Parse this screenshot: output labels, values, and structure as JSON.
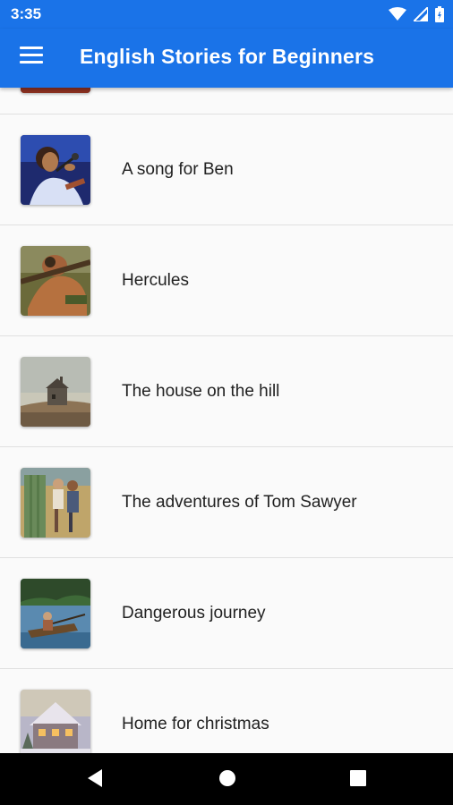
{
  "status_bar": {
    "time": "3:35",
    "icons": [
      "wifi-icon",
      "cell-signal-icon",
      "battery-icon"
    ]
  },
  "app_bar": {
    "menu_icon": "hamburger-menu-icon",
    "title": "English Stories for Beginners",
    "color": "#1a73e8"
  },
  "stories": [
    {
      "title": "",
      "thumbnail": "partial-story-thumbnail"
    },
    {
      "title": "A song for Ben",
      "thumbnail": "singer-with-microphone-image"
    },
    {
      "title": "Hercules",
      "thumbnail": "hercules-painting-image"
    },
    {
      "title": "The house on the hill",
      "thumbnail": "house-on-hill-painting-image"
    },
    {
      "title": "The adventures of Tom Sawyer",
      "thumbnail": "tom-sawyer-fence-painting-image"
    },
    {
      "title": "Dangerous journey",
      "thumbnail": "boat-on-river-painting-image"
    },
    {
      "title": "Home for christmas",
      "thumbnail": "snowy-house-painting-image"
    }
  ],
  "nav_bar": {
    "back": "back-triangle-icon",
    "home": "home-circle-icon",
    "recents": "recents-square-icon"
  }
}
